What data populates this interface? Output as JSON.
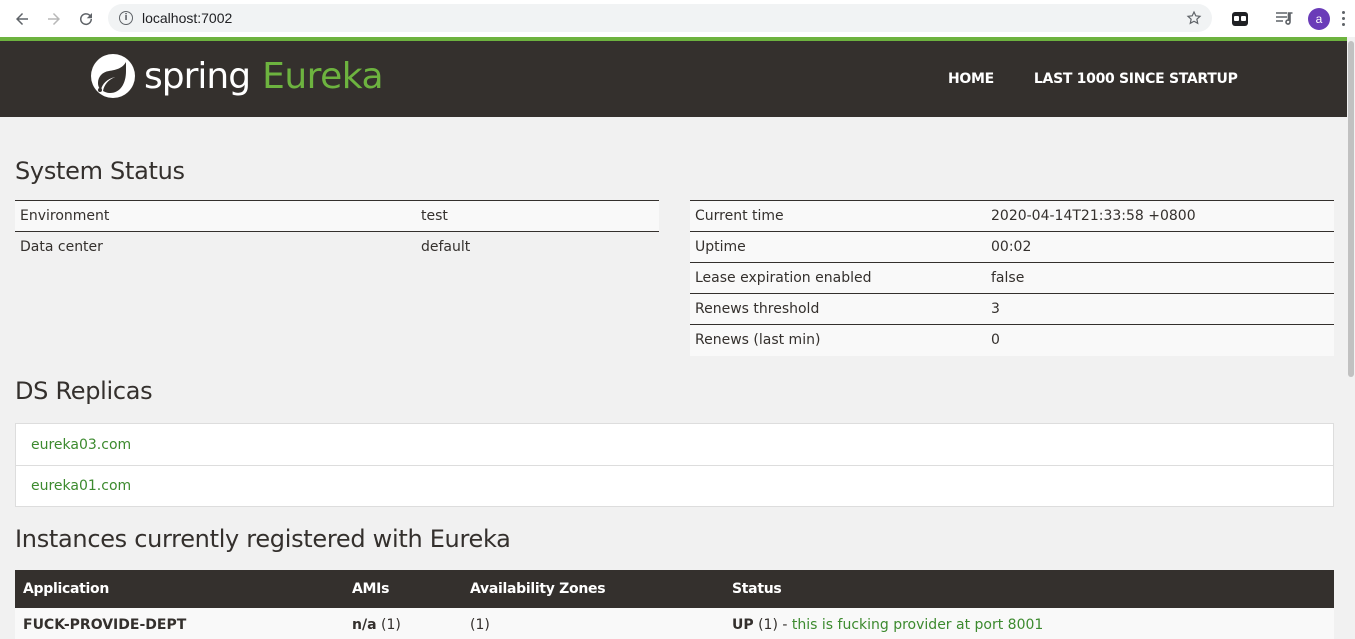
{
  "browser": {
    "url": "localhost:7002",
    "profile_initial": "a"
  },
  "navbar": {
    "logo_word": "spring",
    "logo_product": "Eureka",
    "links": [
      "HOME",
      "LAST 1000 SINCE STARTUP"
    ],
    "accent_color": "#6db33f",
    "bg_color": "#34302d"
  },
  "system_status": {
    "title": "System Status",
    "left": [
      {
        "label": "Environment",
        "value": "test"
      },
      {
        "label": "Data center",
        "value": "default"
      }
    ],
    "right": [
      {
        "label": "Current time",
        "value": "2020-04-14T21:33:58 +0800"
      },
      {
        "label": "Uptime",
        "value": "00:02"
      },
      {
        "label": "Lease expiration enabled",
        "value": "false"
      },
      {
        "label": "Renews threshold",
        "value": "3"
      },
      {
        "label": "Renews (last min)",
        "value": "0"
      }
    ]
  },
  "ds_replicas": {
    "title": "DS Replicas",
    "items": [
      "eureka03.com",
      "eureka01.com"
    ]
  },
  "instances": {
    "title": "Instances currently registered with Eureka",
    "columns": [
      "Application",
      "AMIs",
      "Availability Zones",
      "Status"
    ],
    "rows": [
      {
        "application": "FUCK-PROVIDE-DEPT",
        "amis_name": "n/a",
        "amis_count": "(1)",
        "zones": "(1)",
        "status": "UP",
        "status_count": "(1) - ",
        "status_link": "this is fucking provider at port 8001"
      }
    ]
  }
}
